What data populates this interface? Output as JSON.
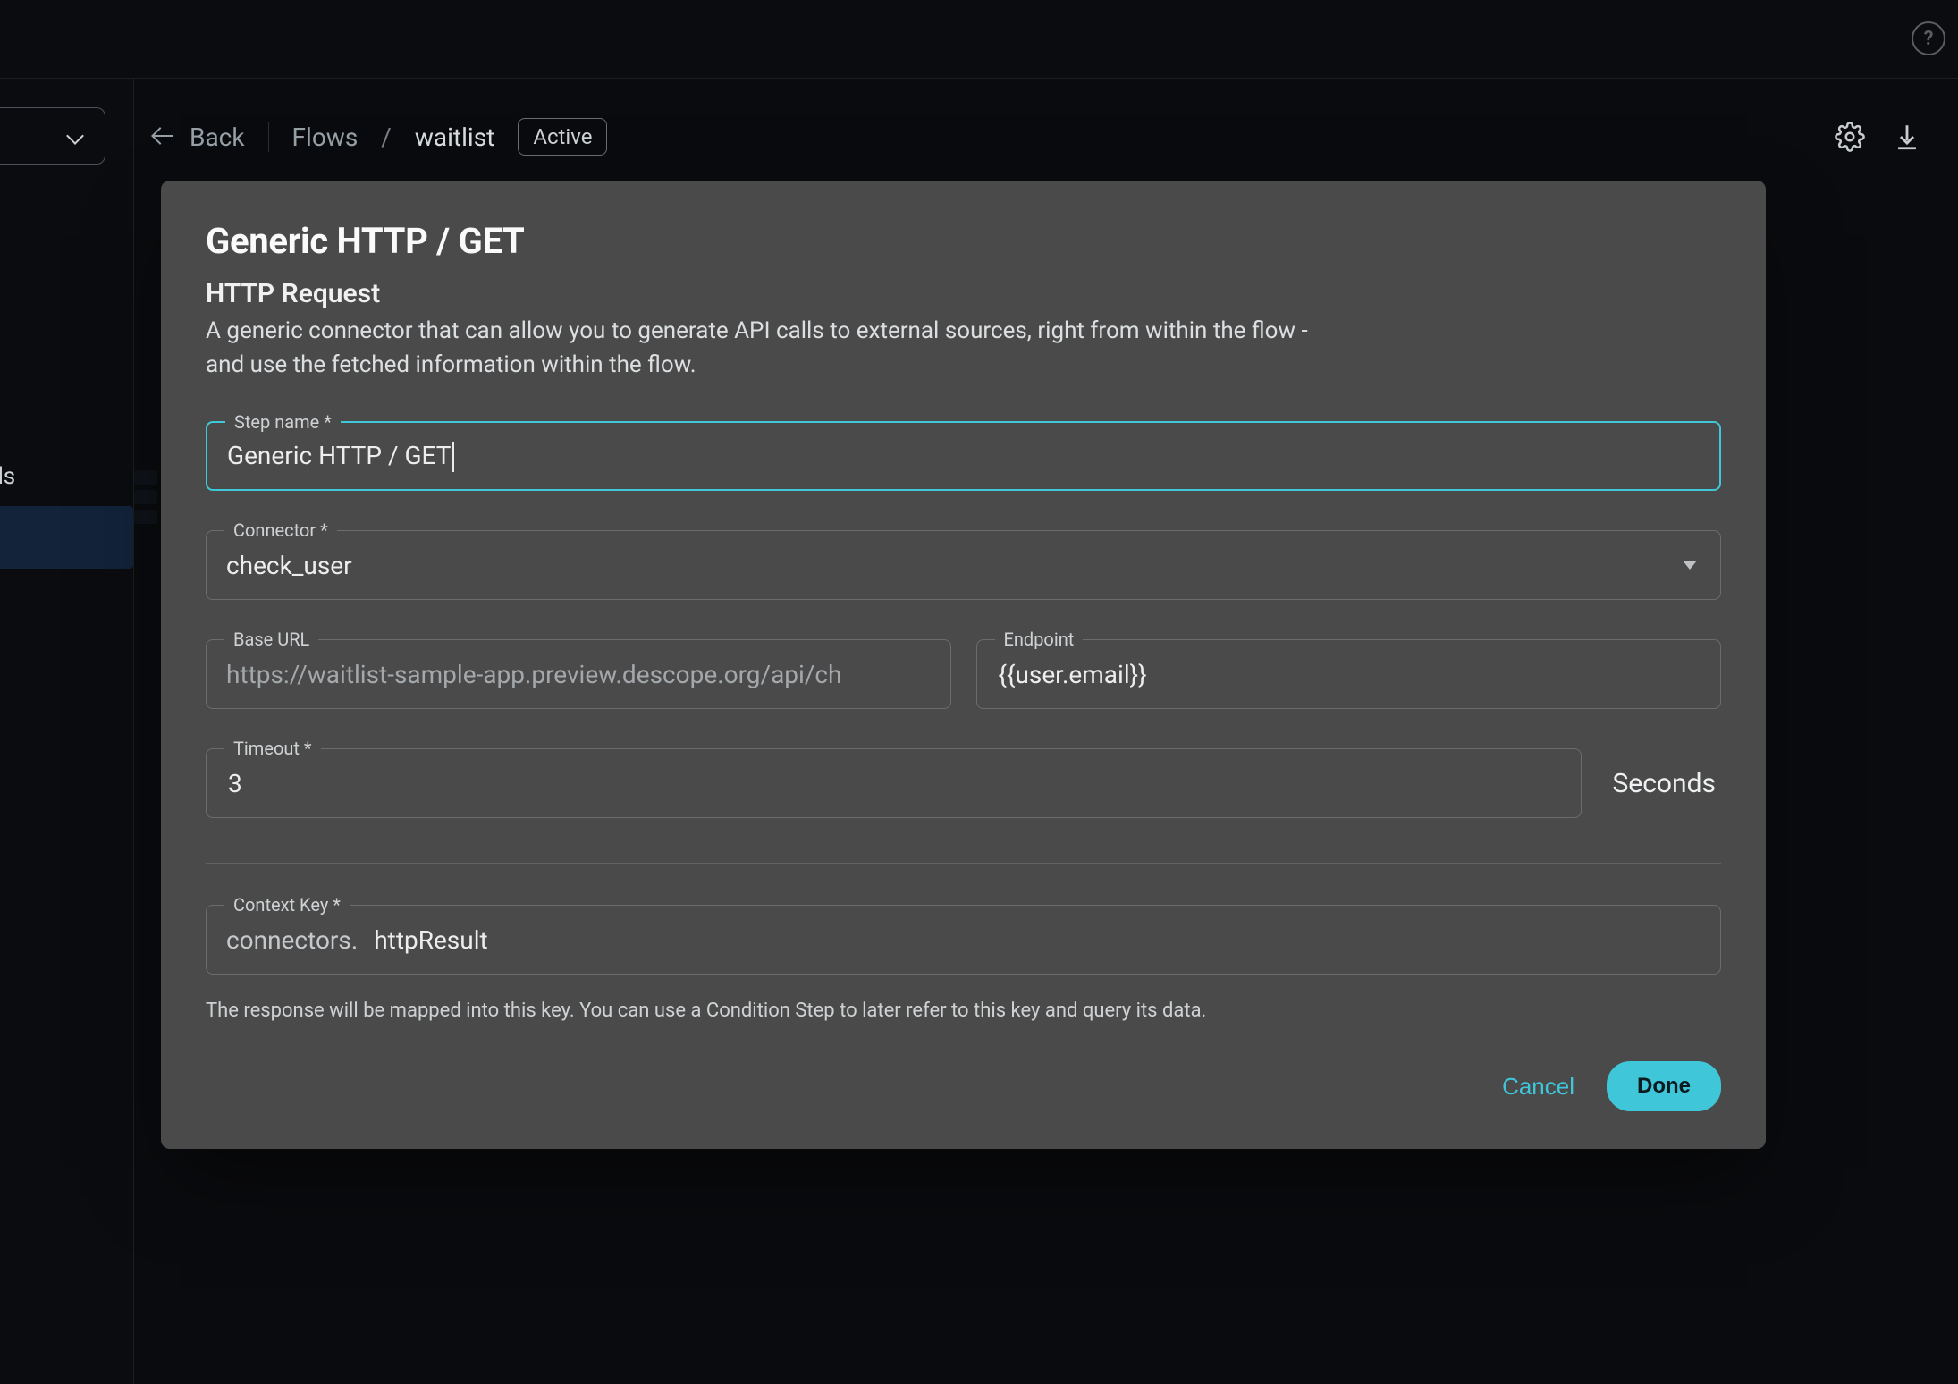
{
  "topbar": {
    "help_symbol": "?"
  },
  "sidebar": {
    "truncated_label": "hods"
  },
  "header": {
    "back_label": "Back",
    "crumb_root": "Flows",
    "crumb_sep": "/",
    "crumb_current": "waitlist",
    "status_badge": "Active"
  },
  "modal": {
    "title": "Generic HTTP / GET",
    "subtitle": "HTTP Request",
    "description": "A generic connector that can allow you to generate API calls to external sources, right from within the flow - and use the fetched information within the flow.",
    "fields": {
      "step_name": {
        "label": "Step name *",
        "value": "Generic HTTP / GET"
      },
      "connector": {
        "label": "Connector *",
        "value": "check_user"
      },
      "base_url": {
        "label": "Base URL",
        "placeholder": "https://waitlist-sample-app.preview.descope.org/api/ch"
      },
      "endpoint": {
        "label": "Endpoint",
        "value": "{{user.email}}"
      },
      "timeout": {
        "label": "Timeout *",
        "value": "3",
        "unit": "Seconds"
      },
      "context_key": {
        "label": "Context Key *",
        "prefix": "connectors.",
        "value": "httpResult"
      }
    },
    "helper_text": "The response will be mapped into this key. You can use a Condition Step to later refer to this key and query its data.",
    "actions": {
      "cancel": "Cancel",
      "done": "Done"
    }
  }
}
